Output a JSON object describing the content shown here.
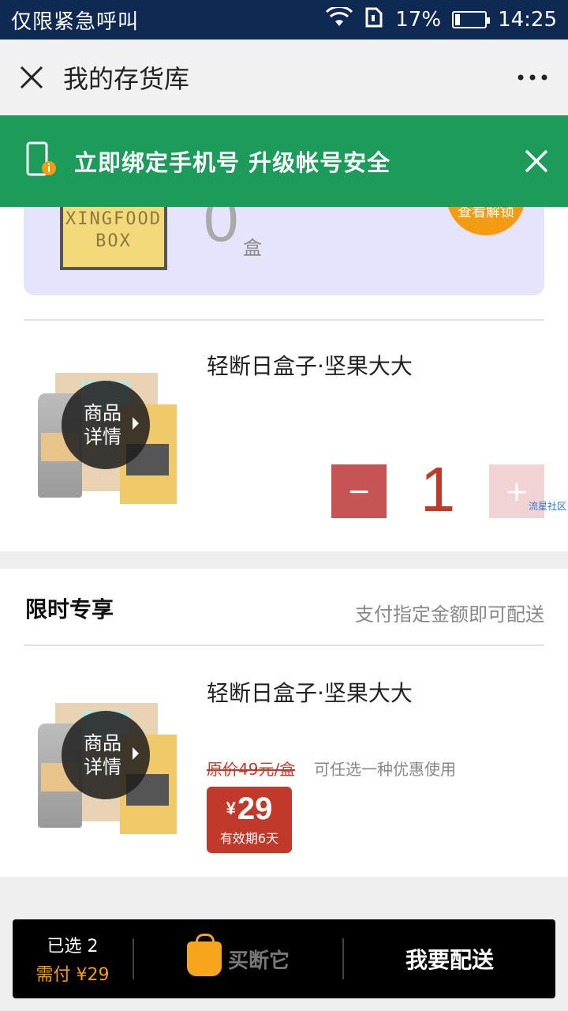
{
  "status_bar": {
    "carrier": "仅限紧急呼叫",
    "battery": "17%",
    "battery_level": 0.17,
    "time": "14:25"
  },
  "navbar": {
    "title": "我的存货库"
  },
  "banner": {
    "text": "立即绑定手机号  升级帐号安全"
  },
  "unlock": {
    "box_text": "XINGFOOD BOX",
    "count": "0",
    "unit": "盒",
    "button": "查看解锁"
  },
  "product1": {
    "name": "轻断日盒子·坚果大大",
    "detail_label": "商品详情",
    "minus": "−",
    "quantity": "1",
    "plus": "+"
  },
  "watermark": "流星社区",
  "promo_section": {
    "title": "限时专享",
    "subtitle": "支付指定金额即可配送",
    "product": {
      "name": "轻断日盒子·坚果大大",
      "detail_label": "商品详情",
      "original_price": "原价49元/盒",
      "note": "可任选一种优惠使用",
      "currency": "¥",
      "price": "29",
      "valid": "有效期6天"
    }
  },
  "bottom_bar": {
    "selected": "已选 2",
    "payable": "需付 ¥29",
    "buy_label": "买断它",
    "deliver_label": "我要配送"
  }
}
